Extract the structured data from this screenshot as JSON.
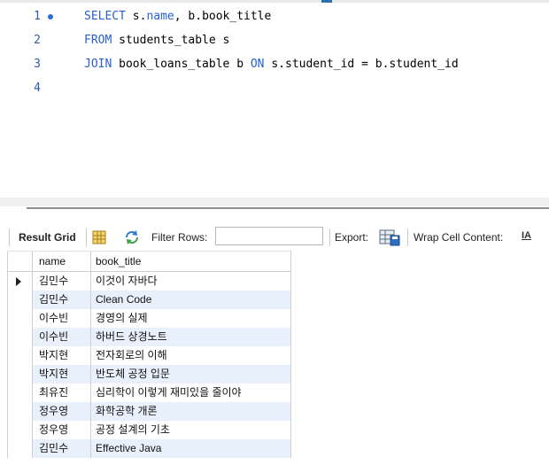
{
  "editor": {
    "lines": [
      {
        "number": "1",
        "active": true,
        "tokens": [
          {
            "text": "SELECT",
            "kw": true
          },
          {
            "text": " s.",
            "kw": false
          },
          {
            "text": "name",
            "kw": true
          },
          {
            "text": ", b.book_title",
            "kw": false
          }
        ]
      },
      {
        "number": "2",
        "active": false,
        "tokens": [
          {
            "text": "FROM",
            "kw": true
          },
          {
            "text": " students_table s",
            "kw": false
          }
        ]
      },
      {
        "number": "3",
        "active": false,
        "tokens": [
          {
            "text": "JOIN",
            "kw": true
          },
          {
            "text": " book_loans_table b ",
            "kw": false
          },
          {
            "text": "ON",
            "kw": true
          },
          {
            "text": " s.student_id = b.student_id",
            "kw": false
          }
        ]
      },
      {
        "number": "4",
        "active": false,
        "tokens": []
      }
    ],
    "keyword_color": "#2a5fd0",
    "line_number_color": "#2f5a9e"
  },
  "toolbar": {
    "result_grid_label": "Result Grid",
    "filter_rows_label": "Filter Rows:",
    "filter_value": "",
    "export_label": "Export:",
    "wrap_label": "Wrap Cell Content:",
    "wrap_icon_text": "IA"
  },
  "grid": {
    "columns": [
      "name",
      "book_title"
    ],
    "rows": [
      {
        "name": "김민수",
        "book_title": "이것이 자바다"
      },
      {
        "name": "김민수",
        "book_title": "Clean Code"
      },
      {
        "name": "이수빈",
        "book_title": "경영의 실제"
      },
      {
        "name": "이수빈",
        "book_title": "하버드 상경노트"
      },
      {
        "name": "박지현",
        "book_title": "전자회로의 이해"
      },
      {
        "name": "박지현",
        "book_title": "반도체 공정 입문"
      },
      {
        "name": "최유진",
        "book_title": "심리학이 이렇게 재미있을 줄이야"
      },
      {
        "name": "정우영",
        "book_title": "화학공학 개론"
      },
      {
        "name": "정우영",
        "book_title": "공정 설계의 기초"
      },
      {
        "name": "김민수",
        "book_title": "Effective Java"
      }
    ],
    "selected_row": 0,
    "stripe_color": "#e8f0fb"
  }
}
